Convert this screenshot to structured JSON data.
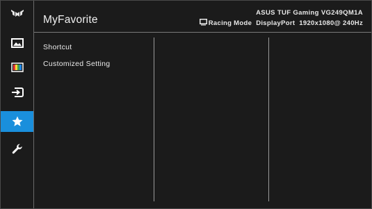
{
  "header": {
    "title": "MyFavorite",
    "model": "ASUS TUF Gaming  VG249QM1A",
    "mode": "Racing Mode",
    "input": "DisplayPort",
    "resolution": "1920x1080@ 240Hz"
  },
  "sidebar": {
    "items": [
      {
        "name": "gaming",
        "icon": "tuf-logo-icon"
      },
      {
        "name": "image",
        "icon": "image-icon"
      },
      {
        "name": "color",
        "icon": "color-bars-icon"
      },
      {
        "name": "input-select",
        "icon": "input-icon"
      },
      {
        "name": "myfavorite",
        "icon": "star-icon",
        "active": true
      },
      {
        "name": "system-setup",
        "icon": "wrench-icon"
      }
    ],
    "accent": "#1a8fdc"
  },
  "menu": {
    "items": [
      "Shortcut",
      "Customized Setting"
    ]
  }
}
